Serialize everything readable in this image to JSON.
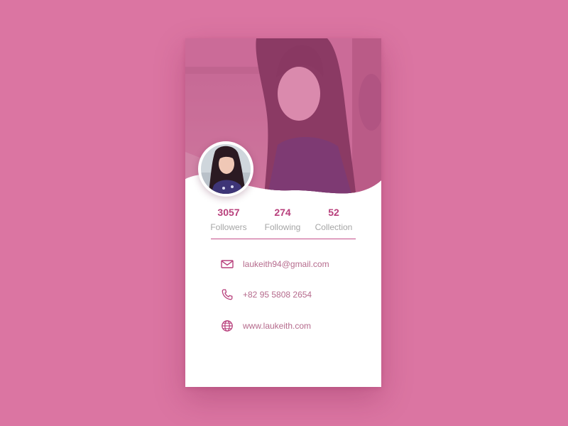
{
  "profile": {
    "stats": [
      {
        "value": "3057",
        "label": "Followers"
      },
      {
        "value": "274",
        "label": "Following"
      },
      {
        "value": "52",
        "label": "Collection"
      }
    ],
    "contacts": [
      {
        "icon": "mail-icon",
        "text": "laukeith94@gmail.com"
      },
      {
        "icon": "phone-icon",
        "text": "+82 95 5808 2654"
      },
      {
        "icon": "globe-icon",
        "text": "www.laukeith.com"
      }
    ]
  },
  "colors": {
    "background": "#db75a2",
    "accent": "#b8407c",
    "hero_overlay": "#c35183",
    "label_gray": "#a6a6a6",
    "contact_text": "#b56a8c"
  }
}
